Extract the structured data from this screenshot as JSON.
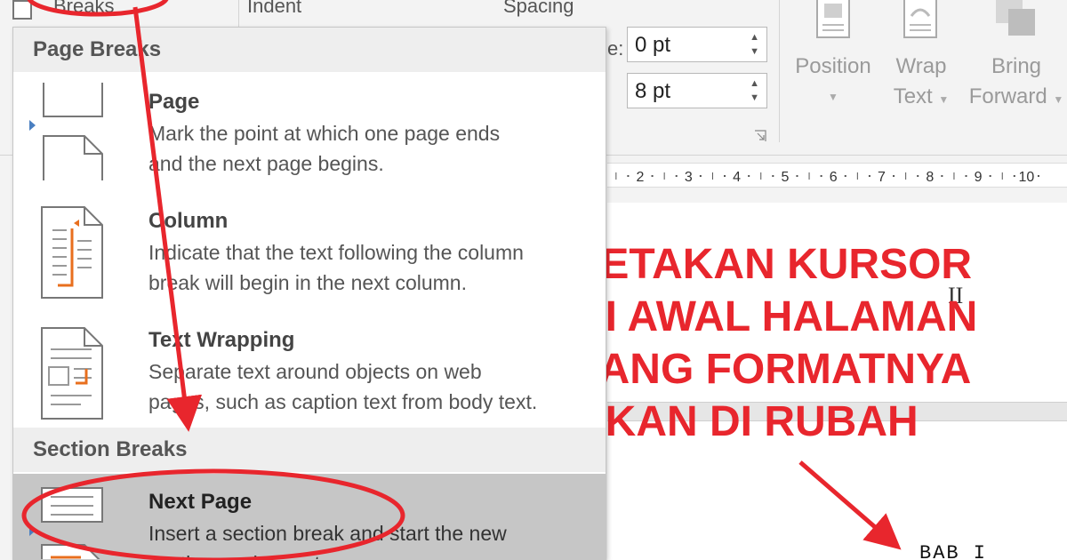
{
  "ribbon": {
    "breaks_label": "Breaks",
    "indent_label": "Indent",
    "spacing_label": "Spacing",
    "spacing_before": "0 pt",
    "spacing_after": "8 pt",
    "colon_fragment": "e:",
    "arrange": {
      "position": [
        "Position",
        ""
      ],
      "wrap_text": [
        "Wrap",
        "Text"
      ],
      "bring_forward": [
        "Bring",
        "Forward"
      ]
    }
  },
  "ruler": {
    "numbers": [
      "2",
      "3",
      "4",
      "5",
      "6",
      "7",
      "8",
      "9",
      "10"
    ]
  },
  "menu": {
    "page_breaks_header": "Page Breaks",
    "section_breaks_header": "Section Breaks",
    "items": [
      {
        "title": "Page",
        "desc": [
          "Mark the point at which one page ends",
          "and the next page begins."
        ]
      },
      {
        "title": "Column",
        "desc": [
          "Indicate that the text following the column",
          "break will begin in the next column."
        ]
      },
      {
        "title": "Text Wrapping",
        "desc": [
          "Separate text around objects on web",
          "pages, such as caption text from body text."
        ]
      },
      {
        "title": "Next Page",
        "desc": [
          "Insert a section break and start the new",
          "section on the next page."
        ]
      }
    ]
  },
  "annotation": {
    "lines": [
      "LETAKAN KURSOR",
      "DI AWAL HALAMAN",
      "YANG FORMATNYA",
      "AKAN DI RUBAH"
    ]
  },
  "document": {
    "cursor_glyph": "II",
    "text": "BAB I"
  },
  "colors": {
    "annotation_red": "#e8262d",
    "menu_selected": "#c6c6c6",
    "header_bg": "#eeeeee",
    "icon_orange": "#e86f1e",
    "pointer_blue": "#4a7fc1"
  }
}
